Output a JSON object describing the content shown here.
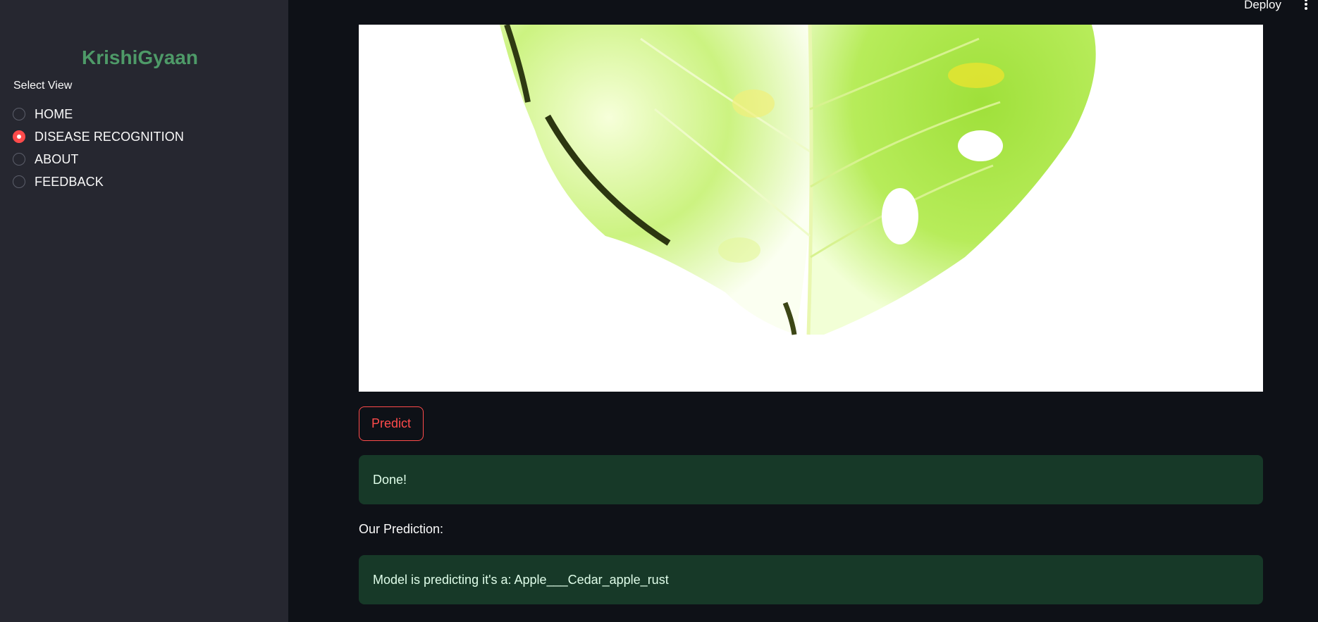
{
  "sidebar": {
    "brand": "KrishiGyaan",
    "select_label": "Select View",
    "options": [
      {
        "label": "HOME",
        "selected": false
      },
      {
        "label": "DISEASE RECOGNITION",
        "selected": true
      },
      {
        "label": "ABOUT",
        "selected": false
      },
      {
        "label": "FEEDBACK",
        "selected": false
      }
    ]
  },
  "header": {
    "deploy_label": "Deploy",
    "menu_icon": "vertical-dots-icon"
  },
  "main": {
    "image_subject": "apple-leaf-image",
    "predict_label": "Predict",
    "done_message": "Done!",
    "prediction_heading": "Our Prediction:",
    "prediction_text": "Model is predicting it's a: Apple___Cedar_apple_rust"
  },
  "colors": {
    "accent": "#ff4b4b",
    "brand": "#4e9a68",
    "success_bg": "#173928",
    "sidebar_bg": "#262730",
    "main_bg": "#0e1117"
  }
}
